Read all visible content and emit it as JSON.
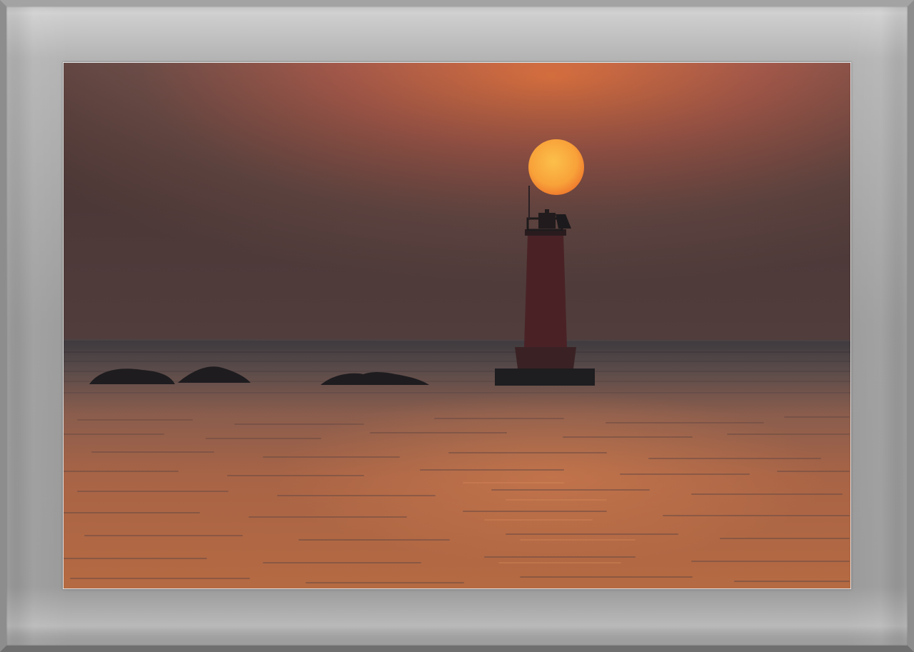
{
  "scene": {
    "subject": "lighthouse",
    "colors": {
      "sky_top": "#c96a45",
      "sky_haze": "#5d4541",
      "sun": "#f7a43a",
      "water": "#b86a43",
      "silhouette": "#1c1a1c",
      "frame": "#9b9b9b"
    }
  }
}
